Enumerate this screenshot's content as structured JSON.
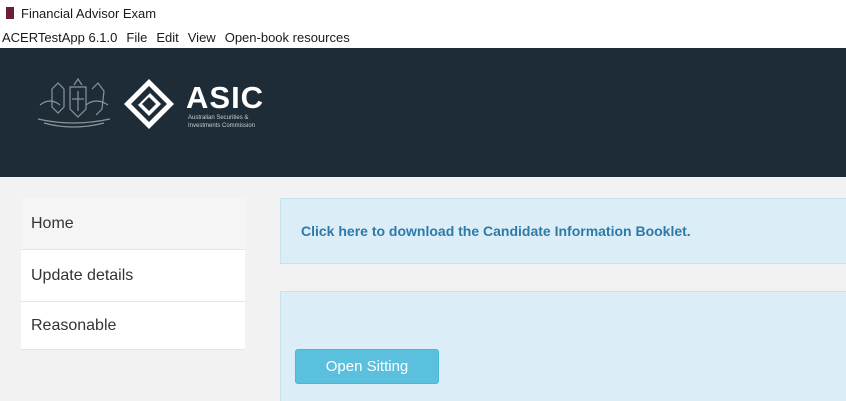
{
  "window": {
    "title": "Financial Advisor Exam",
    "app_icon": "document-icon"
  },
  "menubar": {
    "items": [
      "ACERTestApp 6.1.0",
      "File",
      "Edit",
      "View",
      "Open-book resources"
    ]
  },
  "banner": {
    "logo_title": "ASIC",
    "logo_subtitle_line1": "Australian Securities &",
    "logo_subtitle_line2": "Investments Commission",
    "crest_icon": "coat-of-arms-icon",
    "logo_icon": "asic-diamond-icon",
    "background_color": "#1e2c37"
  },
  "sidebar": {
    "items": [
      {
        "label": "Home",
        "active": true
      },
      {
        "label": "Update details",
        "active": false
      },
      {
        "label": "Reasonable",
        "active": false
      }
    ]
  },
  "main": {
    "download_link": "Click here to download the Candidate Information Booklet.",
    "open_sitting_label": "Open Sitting"
  },
  "colors": {
    "link": "#2f79a8",
    "panel": "#dbeef7",
    "button": "#5bc0de"
  }
}
